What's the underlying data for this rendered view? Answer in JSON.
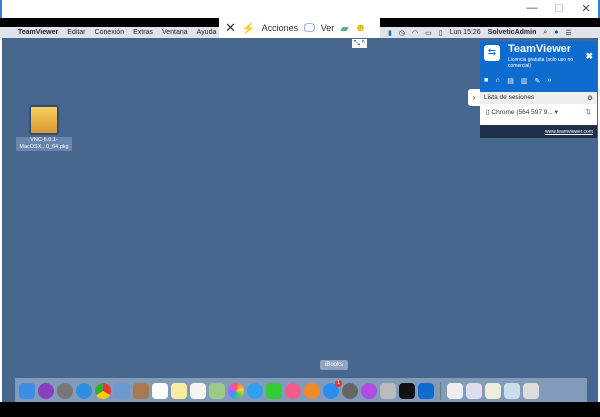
{
  "window": {
    "minimize": "—",
    "maximize": "☐",
    "close": "✕"
  },
  "mac_menu": {
    "app": "TeamViewer",
    "items": [
      "Editar",
      "Conexión",
      "Extras",
      "Ventana",
      "Ayuda"
    ],
    "clock": "Lun 15:26",
    "user": "SolveticAdmin"
  },
  "tv_toolbar": {
    "close": "✕",
    "actions": "Acciones",
    "view": "Ver"
  },
  "desktop_icon": {
    "label_line1": "VNC-6.0.1-",
    "label_line2": "MacOSX...0_64.pkg"
  },
  "tv_panel": {
    "title": "TeamViewer",
    "subtitle": "Licencia gratuita (solo uso no comercial)",
    "sessions_header": "Lista de sesiones",
    "session": "Chrome (564 597 9...",
    "footer": "www.teamviewer.com"
  },
  "dock": {
    "tooltip": "iBooks",
    "appstore_badge": "1"
  }
}
